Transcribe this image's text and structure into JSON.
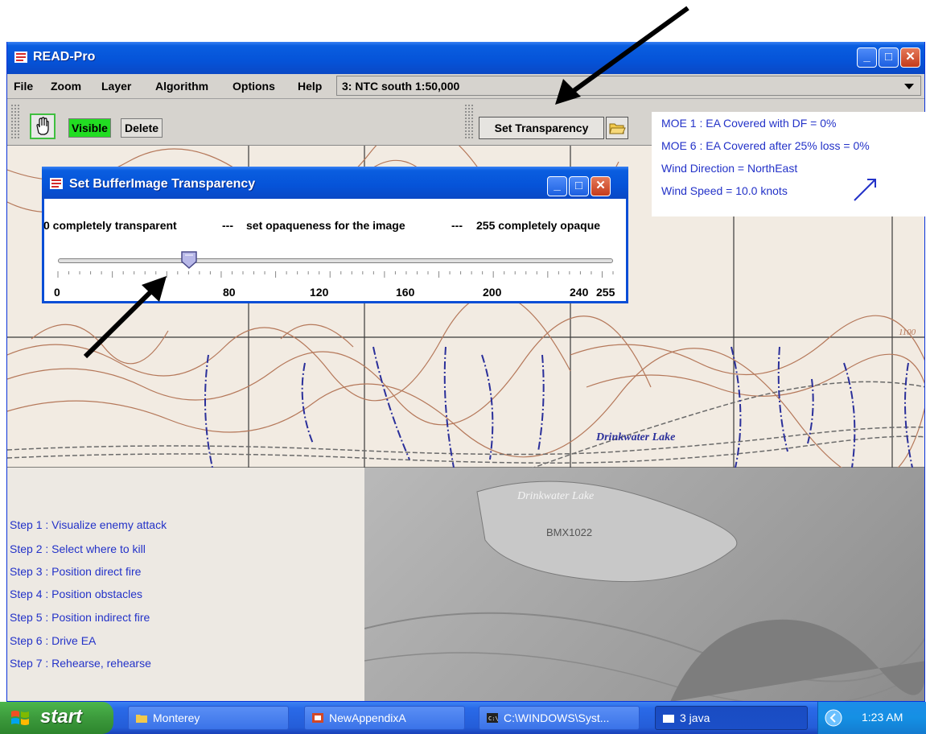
{
  "window": {
    "title": "READ-Pro"
  },
  "menubar": {
    "items": [
      "File",
      "Zoom",
      "Layer",
      "Algorithm",
      "Options",
      "Help"
    ],
    "layer_select": {
      "value": "3: NTC south 1:50,000"
    }
  },
  "toolbar": {
    "visible_label": "Visible",
    "delete_label": "Delete",
    "set_transparency_label": "Set Transparency"
  },
  "info_panel": {
    "lines": [
      "MOE 1 : EA Covered with DF =  0%",
      "MOE 6 : EA Covered after 25% loss =  0%",
      "Wind Direction = NorthEast",
      "Wind Speed = 10.0 knots"
    ]
  },
  "dialog": {
    "title": "Set BufferImage Transparency",
    "desc_left": "0 completely transparent",
    "sep1": "---",
    "desc_mid": "set opaqueness for the image",
    "sep2": "---",
    "desc_right": "255 completely opaque",
    "slider": {
      "min": 0,
      "max": 255,
      "value": 62,
      "labels": [
        "0",
        "80",
        "120",
        "160",
        "200",
        "240",
        "255"
      ]
    }
  },
  "map": {
    "lake_label": "Drinkwater Lake",
    "photo_lake_label": "Drinkwater Lake",
    "bm_label": "BMX1022",
    "contour_label": "1100"
  },
  "steps": [
    "Step 1 :  Visualize enemy attack",
    "Step 2 :  Select where to kill",
    "Step 3 :  Position direct fire",
    "Step 4 :  Position obstacles",
    "Step 5 :  Position indirect fire",
    "Step 6 :  Drive EA",
    "Step 7 :  Rehearse, rehearse"
  ],
  "taskbar": {
    "start_label": "start",
    "tasks": [
      "Monterey",
      "NewAppendixA",
      "C:\\WINDOWS\\Syst...",
      "3 java"
    ],
    "clock": "1:23 AM"
  },
  "colors": {
    "xp_blue": "#0553d8",
    "info_text": "#2332c8",
    "visible_green": "#22dd22",
    "contour_brown": "#b5785a",
    "water_blue": "#2a2f9a"
  }
}
